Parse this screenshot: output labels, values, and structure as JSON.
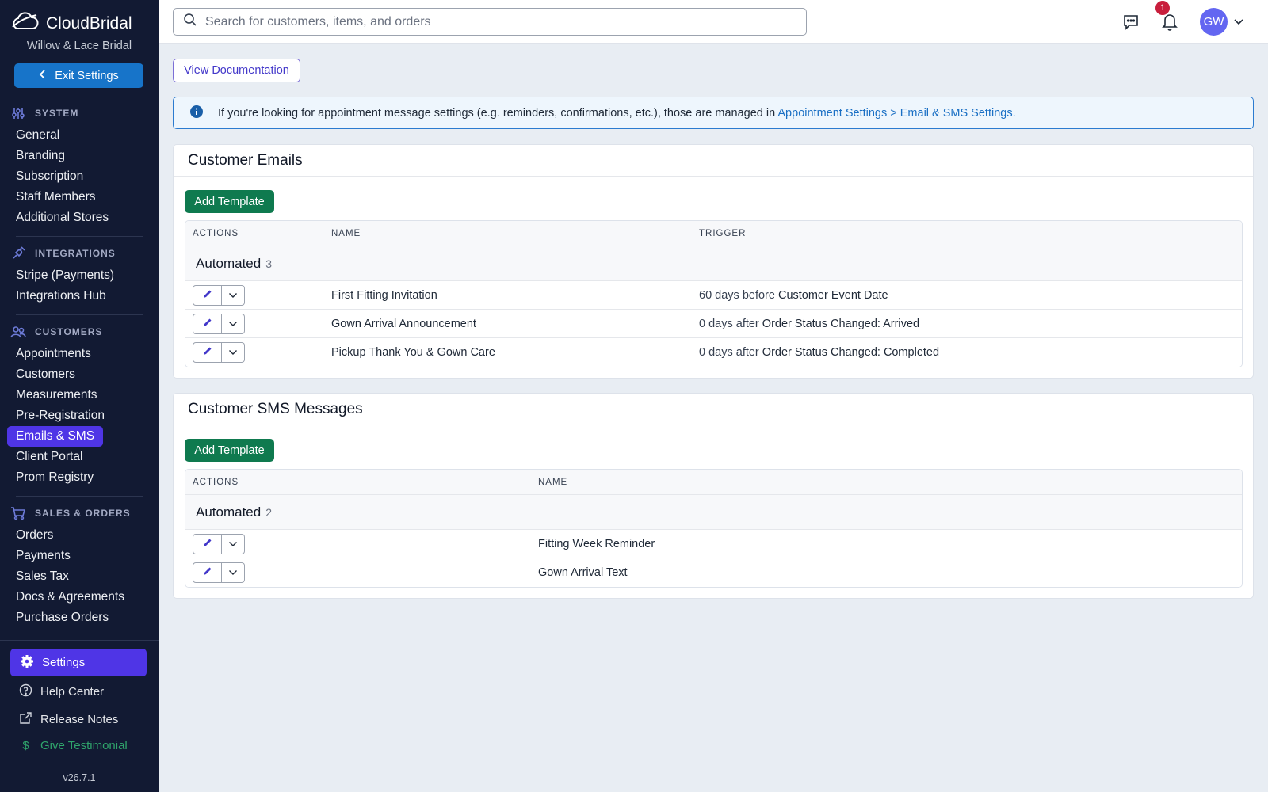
{
  "app": {
    "brand_name": "CloudBridal",
    "store_name": "Willow & Lace Bridal",
    "exit_label": "Exit Settings",
    "version": "v26.7.1"
  },
  "sidebar": {
    "sections": [
      {
        "title": "SYSTEM",
        "icon": "sliders-icon",
        "items": [
          "General",
          "Branding",
          "Subscription",
          "Staff Members",
          "Additional Stores"
        ]
      },
      {
        "title": "INTEGRATIONS",
        "icon": "plug-icon",
        "items": [
          "Stripe (Payments)",
          "Integrations Hub"
        ]
      },
      {
        "title": "CUSTOMERS",
        "icon": "users-icon",
        "items": [
          "Appointments",
          "Customers",
          "Measurements",
          "Pre-Registration",
          "Emails & SMS",
          "Client Portal",
          "Prom Registry"
        ]
      },
      {
        "title": "SALES & ORDERS",
        "icon": "cart-icon",
        "items": [
          "Orders",
          "Payments",
          "Sales Tax",
          "Docs & Agreements",
          "Purchase Orders"
        ]
      }
    ],
    "active_item": "Emails & SMS",
    "bottom": {
      "settings_label": "Settings",
      "help_label": "Help Center",
      "release_label": "Release Notes",
      "testimonial_label": "Give Testimonial"
    }
  },
  "header": {
    "search_placeholder": "Search for customers, items, and orders",
    "notification_count": "1",
    "avatar_initials": "GW"
  },
  "main": {
    "doc_button": "View Documentation",
    "info_text": "If you're looking for appointment message settings (e.g. reminders, confirmations, etc.), those are managed in",
    "info_link": "Appointment Settings > Email & SMS Settings.",
    "emails": {
      "title": "Customer Emails",
      "add_label": "Add Template",
      "columns": [
        "ACTIONS",
        "NAME",
        "TRIGGER"
      ],
      "group_label": "Automated",
      "group_count": "3",
      "rows": [
        {
          "name": "First Fitting Invitation",
          "trigger_prefix": "60 days before",
          "trigger_event": "Customer Event Date"
        },
        {
          "name": "Gown Arrival Announcement",
          "trigger_prefix": "0 days after",
          "trigger_event": "Order Status Changed: Arrived"
        },
        {
          "name": "Pickup Thank You & Gown Care",
          "trigger_prefix": "0 days after",
          "trigger_event": "Order Status Changed: Completed"
        }
      ]
    },
    "sms": {
      "title": "Customer SMS Messages",
      "add_label": "Add Template",
      "columns": [
        "ACTIONS",
        "NAME"
      ],
      "group_label": "Automated",
      "group_count": "2",
      "rows": [
        {
          "name": "Fitting Week Reminder"
        },
        {
          "name": "Gown Arrival Text"
        }
      ]
    }
  },
  "colors": {
    "sidebar_bg": "#121a33",
    "accent_purple": "#4f35e6",
    "primary_blue": "#1774c9",
    "success_green": "#0f7a4f",
    "badge_red": "#c81e3c"
  }
}
